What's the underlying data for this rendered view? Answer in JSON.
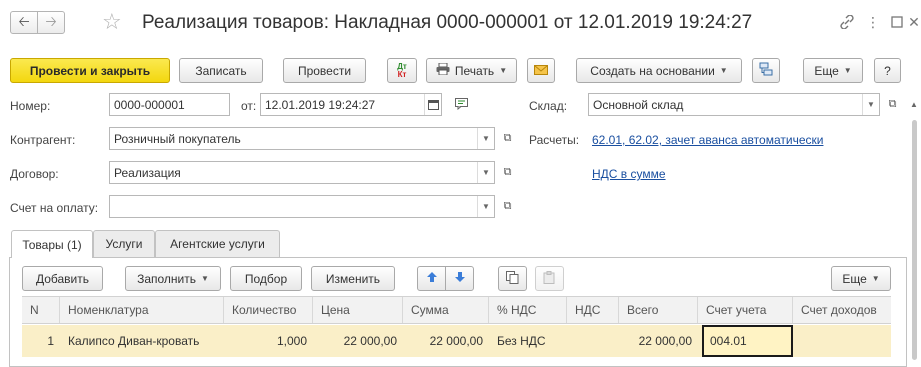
{
  "window": {
    "title": "Реализация товаров: Накладная 0000-000001 от 12.01.2019 19:24:27"
  },
  "toolbar": {
    "post_and_close": "Провести и закрыть",
    "save": "Записать",
    "post": "Провести",
    "dt_kt_top": "Дт",
    "dt_kt_bottom": "Кт",
    "print": "Печать",
    "create_based_on": "Создать на основании",
    "more": "Еще",
    "help": "?"
  },
  "form": {
    "number_label": "Номер:",
    "number_value": "0000-000001",
    "date_label": "от:",
    "date_value": "12.01.2019 19:24:27",
    "warehouse_label": "Склад:",
    "warehouse_value": "Основной склад",
    "counterparty_label": "Контрагент:",
    "counterparty_value": "Розничный покупатель",
    "settlements_label": "Расчеты:",
    "settlements_link": "62.01, 62.02, зачет аванса автоматически",
    "contract_label": "Договор:",
    "contract_value": "Реализация",
    "vat_link": "НДС в сумме",
    "invoice_label": "Счет на оплату:",
    "invoice_value": ""
  },
  "tabs": [
    {
      "label": "Товары (1)",
      "active": true
    },
    {
      "label": "Услуги",
      "active": false
    },
    {
      "label": "Агентские услуги",
      "active": false
    }
  ],
  "table_toolbar": {
    "add": "Добавить",
    "fill": "Заполнить",
    "select": "Подбор",
    "change": "Изменить",
    "more": "Еще"
  },
  "table": {
    "columns": [
      "N",
      "Номенклатура",
      "Количество",
      "Цена",
      "Сумма",
      "% НДС",
      "НДС",
      "Всего",
      "Счет учета",
      "Счет доходов"
    ],
    "rows": [
      [
        "1",
        "Калипсо Диван-кровать",
        "1,000",
        "22 000,00",
        "22 000,00",
        "Без НДС",
        "",
        "22 000,00",
        "004.01",
        ""
      ]
    ]
  },
  "colors": {
    "primary_button": "#f3d70f",
    "link": "#1a4fa0",
    "selected_row": "#faefc8"
  }
}
